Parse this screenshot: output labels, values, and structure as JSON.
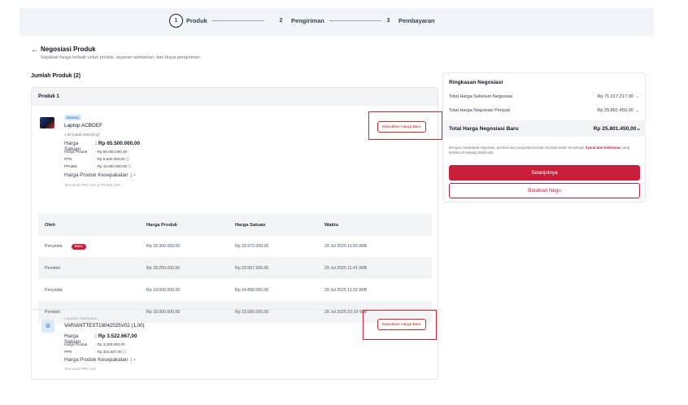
{
  "stepper": {
    "steps": [
      {
        "num": "1",
        "label": "Produk"
      },
      {
        "num": "2",
        "label": "Pengiriman"
      },
      {
        "num": "3",
        "label": "Pembayaran"
      }
    ]
  },
  "header": {
    "back_icon": "arrow-left-icon",
    "title": "Negosiasi Produk",
    "subtitle": "Sepakati harga terbaik untuk produk, layanan tambahan, dan biaya pengiriman.",
    "jumlah": "Jumlah Produk (2)"
  },
  "product1": {
    "panel_title": "Produk 1",
    "badge": "Barang",
    "name": "Laptop ACBDEF",
    "qty": "1,00 Kotak (100,00 gr)",
    "harga_satuan_label": "Harga Satuan",
    "harga_satuan_value": ": Rp 65.500.000,00",
    "harga_produk_label": "Harga Produk",
    "harga_produk_value": ": Rp 50.000.000,00",
    "ppn_label": "PPN",
    "ppn_value": ": Rp 5.500.000,00 ⓘ",
    "ppnbm_label": "PPnBM",
    "ppnbm_value": ": Rp 10.000.000,00 ⓘ",
    "kesepakatan_label": "Harga Produk Kesepakatan",
    "kesepakatan_value": ": -",
    "note": "Termasuk PPN 11% & PPnBM 20%",
    "button": "Masukkan Harga Baru"
  },
  "table": {
    "headers": [
      "Oleh",
      "Harga Produk",
      "Harga Satuan",
      "Waktu"
    ],
    "rows": [
      {
        "oleh": "Penyedia",
        "badge": "Baru",
        "harga_produk": "Rp 18.300.000,00",
        "harga_satuan": "Rp 23.973.000,00",
        "waktu": "29 Jul 2025 11:50 WIB"
      },
      {
        "oleh": "Pembeli",
        "badge": "",
        "harga_produk": "Rp 18.250.000,00",
        "harga_satuan": "Rp 23.907.500,00",
        "waktu": "29 Jul 2025 11:41 WIB"
      },
      {
        "oleh": "Penyedia",
        "badge": "",
        "harga_produk": "Rp 19.000.000,00",
        "harga_satuan": "Rp 24.890.000,00",
        "waktu": "29 Jul 2025 11:02 WIB"
      },
      {
        "oleh": "Pembeli",
        "badge": "",
        "harga_produk": "Rp 18.000.000,00",
        "harga_satuan": "Rp 23.580.000,00",
        "waktu": "28 Jul 2025 23:16 WIB"
      }
    ]
  },
  "service": {
    "icon": "service-icon",
    "category": "Layanan Tambahan",
    "name": "VARIANTTEST19042025V02 (1,00)",
    "harga_satuan_label": "Harga Satuan",
    "harga_satuan_value": ": Rp 3.522.667,00",
    "harga_produk_label": "Harga Produk",
    "harga_produk_value": ": Rp 3.200.000,00",
    "ppn_label": "PPN",
    "ppn_value": ": Rp 322.667,00 ⓘ",
    "kesepakatan_label": "Harga Produk Kesepakatan",
    "kesepakatan_value": ": -",
    "note": "Termasuk PPN 11%",
    "button": "Masukkan Harga Baru"
  },
  "summary": {
    "title": "Ringkasan Negosiasi",
    "row1_label": "Total Harga Sebelum Negosiasi",
    "row1_value": "Rp 71.017.217,00",
    "row2_label": "Total Harga Negosiasi Penjual",
    "row2_value": "Rp 25.801.450,00",
    "total_label": "Total Harga Negosiasi Baru",
    "total_value": "Rp 25.801.450,00",
    "note_pre": "Dengan melakukan negosiasi, pembeli dan penyedia tercatat otomatis telah menyetujui",
    "note_link": "Syarat dan Ketentuan",
    "note_post": "yang berlaku di Katalog Elektronik.",
    "primary_button": "Selanjutnya",
    "secondary_button": "Batalkan Nego",
    "chevron_icon": "chevron-down-icon"
  },
  "colors": {
    "accent": "#c81e3a",
    "highlight": "#e11d2e",
    "stepper_bg": "#f1f5f9"
  }
}
